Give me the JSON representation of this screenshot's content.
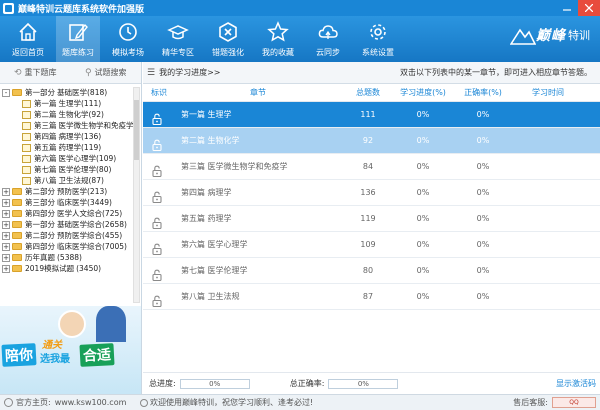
{
  "window": {
    "title": "巅峰特训云题库系统软件加强版"
  },
  "toolbar": {
    "items": [
      {
        "label": "返回首页",
        "icon": "home-icon"
      },
      {
        "label": "题库练习",
        "icon": "edit-icon"
      },
      {
        "label": "模拟考场",
        "icon": "clock-icon"
      },
      {
        "label": "精华专区",
        "icon": "graduation-cap-icon"
      },
      {
        "label": "错题强化",
        "icon": "hexagon-error-icon"
      },
      {
        "label": "我的收藏",
        "icon": "star-icon"
      },
      {
        "label": "云同步",
        "icon": "cloud-sync-icon"
      },
      {
        "label": "系统设置",
        "icon": "gear-icon"
      }
    ],
    "active_index": 1,
    "brand": "巅峰",
    "brand_sub": "特训"
  },
  "sidebar": {
    "tab_refresh": "重下题库",
    "tab_search": "试题搜索",
    "tree": [
      {
        "level": 0,
        "pm": "-",
        "label": "第一部分",
        "tail": "基础医学(818)"
      },
      {
        "level": 1,
        "label": "第一篇",
        "tail": "生理学(111)"
      },
      {
        "level": 1,
        "label": "第二篇",
        "tail": "生物化学(92)"
      },
      {
        "level": 1,
        "label": "第三篇",
        "tail": "医学微生物学和免疫学"
      },
      {
        "level": 1,
        "label": "第四篇",
        "tail": "病理学(136)"
      },
      {
        "level": 1,
        "label": "第五篇",
        "tail": "药理学(119)"
      },
      {
        "level": 1,
        "label": "第六篇",
        "tail": "医学心理学(109)"
      },
      {
        "level": 1,
        "label": "第七篇",
        "tail": "医学伦理学(80)"
      },
      {
        "level": 1,
        "label": "第八篇",
        "tail": "卫生法规(87)"
      },
      {
        "level": 0,
        "pm": "+",
        "label": "第二部分",
        "tail": "预防医学(213)"
      },
      {
        "level": 0,
        "pm": "+",
        "label": "第三部分",
        "tail": "临床医学(3449)"
      },
      {
        "level": 0,
        "pm": "+",
        "label": "第四部分",
        "tail": "医学人文综合(725)"
      },
      {
        "level": 0,
        "pm": "+",
        "label": "第一部分",
        "tail": "基础医学综合(2658)"
      },
      {
        "level": 0,
        "pm": "+",
        "label": "第二部分",
        "tail": "预防医学综合(455)"
      },
      {
        "level": 0,
        "pm": "+",
        "label": "第四部分",
        "tail": "临床医学综合(7005)"
      },
      {
        "level": 0,
        "pm": "+",
        "label": "历年真题",
        "tail": "(5388)"
      },
      {
        "level": 0,
        "pm": "+",
        "label": "2019模拟试题",
        "tail": "(3450)"
      }
    ],
    "banner": {
      "left": "陪你",
      "mid_top": "通关",
      "mid_bottom": "选我最",
      "right": "合适"
    }
  },
  "main": {
    "progress_label": "我的学习进度>>",
    "hint": "双击以下列表中的某一章节，即可进入相应章节答题。",
    "columns": [
      "标识",
      "章节",
      "总题数",
      "学习进度(%)",
      "正确率(%)",
      "学习时间"
    ],
    "rows": [
      {
        "chapter": "第一篇  生理学",
        "total": "111",
        "progress": "0%",
        "accuracy": "0%",
        "time": ""
      },
      {
        "chapter": "第二篇  生物化学",
        "total": "92",
        "progress": "0%",
        "accuracy": "0%",
        "time": ""
      },
      {
        "chapter": "第三篇  医学微生物学和免疫学",
        "total": "84",
        "progress": "0%",
        "accuracy": "0%",
        "time": ""
      },
      {
        "chapter": "第四篇  病理学",
        "total": "136",
        "progress": "0%",
        "accuracy": "0%",
        "time": ""
      },
      {
        "chapter": "第五篇  药理学",
        "total": "119",
        "progress": "0%",
        "accuracy": "0%",
        "time": ""
      },
      {
        "chapter": "第六篇  医学心理学",
        "total": "109",
        "progress": "0%",
        "accuracy": "0%",
        "time": ""
      },
      {
        "chapter": "第七篇  医学伦理学",
        "total": "80",
        "progress": "0%",
        "accuracy": "0%",
        "time": ""
      },
      {
        "chapter": "第八篇  卫生法规",
        "total": "87",
        "progress": "0%",
        "accuracy": "0%",
        "time": ""
      }
    ],
    "selected_index": 0,
    "hover_index": 1,
    "total_progress_label": "总进度:",
    "total_progress_value": "0%",
    "total_accuracy_label": "总正确率:",
    "total_accuracy_value": "0%",
    "activate": "显示激活码"
  },
  "statusbar": {
    "site": "官方主页:",
    "url": "www.ksw100.com",
    "welcome": "欢迎使用巅峰特训，祝您学习顺利、逢考必过!",
    "cs": "售后客服:"
  },
  "colors": {
    "brand_blue": "#1a86d6",
    "selected_row": "#1a86d6",
    "hover_row": "#a8d1f2",
    "close_red": "#e84c3d"
  }
}
